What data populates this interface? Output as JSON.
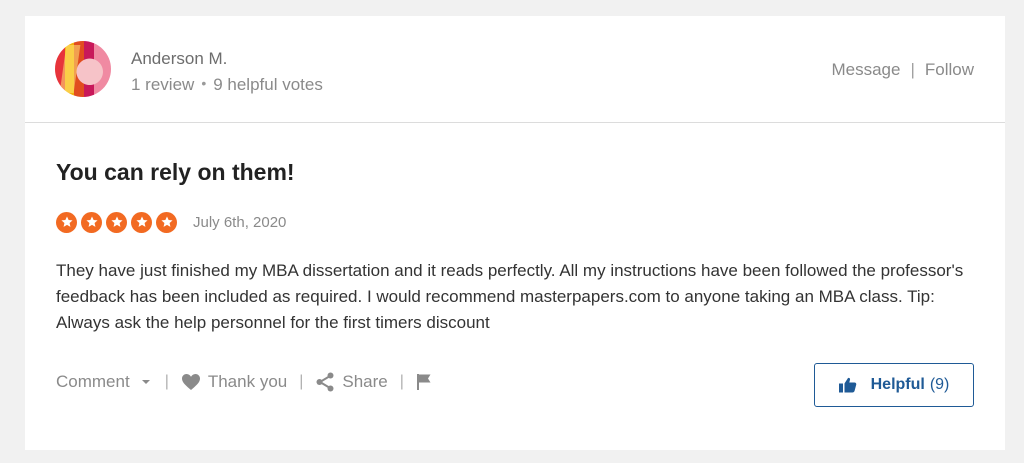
{
  "reviewer": {
    "name": "Anderson M.",
    "review_count": "1 review",
    "separator_dot": "•",
    "helpful_votes": "9 helpful votes"
  },
  "header_actions": {
    "message_label": "Message",
    "separator": "|",
    "follow_label": "Follow"
  },
  "review": {
    "title": "You can rely on them!",
    "rating": 5,
    "rating_max": 5,
    "date": "July 6th, 2020",
    "body": "They have just finished my MBA dissertation and it reads perfectly. All my instructions have been followed the professor's feedback has been included as required. I would recommend masterpapers.com to anyone taking an MBA class. Tip: Always ask the help personnel for the first timers discount"
  },
  "footer_actions": {
    "comment_label": "Comment",
    "thank_label": "Thank you",
    "share_label": "Share",
    "separator": "|"
  },
  "helpful_button": {
    "label": "Helpful",
    "count": "(9)"
  },
  "icons": {
    "star": "star-icon",
    "chevron": "chevron-down-icon",
    "heart": "heart-icon",
    "share": "share-icon",
    "flag": "flag-icon",
    "thumb": "thumbs-up-icon"
  },
  "colors": {
    "star": "#f26a22",
    "helpful_accent": "#1f5a96",
    "background": "#f1f1f1"
  }
}
